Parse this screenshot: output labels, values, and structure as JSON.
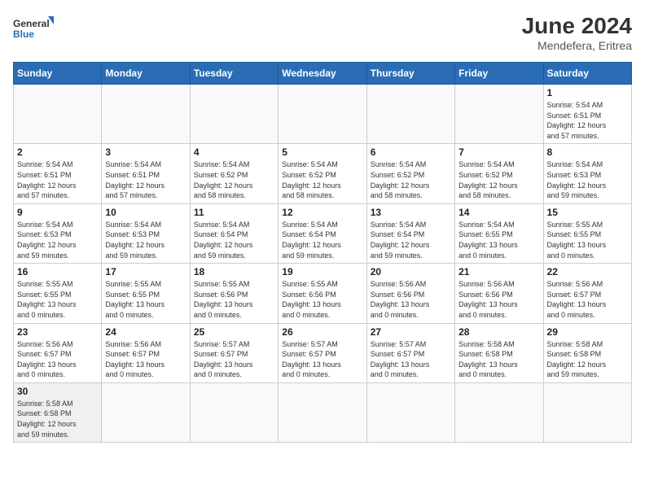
{
  "logo": {
    "general": "General",
    "blue": "Blue"
  },
  "header": {
    "month_year": "June 2024",
    "location": "Mendefera, Eritrea"
  },
  "weekdays": [
    "Sunday",
    "Monday",
    "Tuesday",
    "Wednesday",
    "Thursday",
    "Friday",
    "Saturday"
  ],
  "weeks": [
    [
      {
        "day": "",
        "info": ""
      },
      {
        "day": "",
        "info": ""
      },
      {
        "day": "",
        "info": ""
      },
      {
        "day": "",
        "info": ""
      },
      {
        "day": "",
        "info": ""
      },
      {
        "day": "",
        "info": ""
      },
      {
        "day": "1",
        "info": "Sunrise: 5:54 AM\nSunset: 6:51 PM\nDaylight: 12 hours\nand 57 minutes."
      }
    ],
    [
      {
        "day": "2",
        "info": "Sunrise: 5:54 AM\nSunset: 6:51 PM\nDaylight: 12 hours\nand 57 minutes."
      },
      {
        "day": "3",
        "info": "Sunrise: 5:54 AM\nSunset: 6:51 PM\nDaylight: 12 hours\nand 57 minutes."
      },
      {
        "day": "4",
        "info": "Sunrise: 5:54 AM\nSunset: 6:52 PM\nDaylight: 12 hours\nand 58 minutes."
      },
      {
        "day": "5",
        "info": "Sunrise: 5:54 AM\nSunset: 6:52 PM\nDaylight: 12 hours\nand 58 minutes."
      },
      {
        "day": "6",
        "info": "Sunrise: 5:54 AM\nSunset: 6:52 PM\nDaylight: 12 hours\nand 58 minutes."
      },
      {
        "day": "7",
        "info": "Sunrise: 5:54 AM\nSunset: 6:52 PM\nDaylight: 12 hours\nand 58 minutes."
      },
      {
        "day": "8",
        "info": "Sunrise: 5:54 AM\nSunset: 6:53 PM\nDaylight: 12 hours\nand 59 minutes."
      }
    ],
    [
      {
        "day": "9",
        "info": "Sunrise: 5:54 AM\nSunset: 6:53 PM\nDaylight: 12 hours\nand 59 minutes."
      },
      {
        "day": "10",
        "info": "Sunrise: 5:54 AM\nSunset: 6:53 PM\nDaylight: 12 hours\nand 59 minutes."
      },
      {
        "day": "11",
        "info": "Sunrise: 5:54 AM\nSunset: 6:54 PM\nDaylight: 12 hours\nand 59 minutes."
      },
      {
        "day": "12",
        "info": "Sunrise: 5:54 AM\nSunset: 6:54 PM\nDaylight: 12 hours\nand 59 minutes."
      },
      {
        "day": "13",
        "info": "Sunrise: 5:54 AM\nSunset: 6:54 PM\nDaylight: 12 hours\nand 59 minutes."
      },
      {
        "day": "14",
        "info": "Sunrise: 5:54 AM\nSunset: 6:55 PM\nDaylight: 13 hours\nand 0 minutes."
      },
      {
        "day": "15",
        "info": "Sunrise: 5:55 AM\nSunset: 6:55 PM\nDaylight: 13 hours\nand 0 minutes."
      }
    ],
    [
      {
        "day": "16",
        "info": "Sunrise: 5:55 AM\nSunset: 6:55 PM\nDaylight: 13 hours\nand 0 minutes."
      },
      {
        "day": "17",
        "info": "Sunrise: 5:55 AM\nSunset: 6:55 PM\nDaylight: 13 hours\nand 0 minutes."
      },
      {
        "day": "18",
        "info": "Sunrise: 5:55 AM\nSunset: 6:56 PM\nDaylight: 13 hours\nand 0 minutes."
      },
      {
        "day": "19",
        "info": "Sunrise: 5:55 AM\nSunset: 6:56 PM\nDaylight: 13 hours\nand 0 minutes."
      },
      {
        "day": "20",
        "info": "Sunrise: 5:56 AM\nSunset: 6:56 PM\nDaylight: 13 hours\nand 0 minutes."
      },
      {
        "day": "21",
        "info": "Sunrise: 5:56 AM\nSunset: 6:56 PM\nDaylight: 13 hours\nand 0 minutes."
      },
      {
        "day": "22",
        "info": "Sunrise: 5:56 AM\nSunset: 6:57 PM\nDaylight: 13 hours\nand 0 minutes."
      }
    ],
    [
      {
        "day": "23",
        "info": "Sunrise: 5:56 AM\nSunset: 6:57 PM\nDaylight: 13 hours\nand 0 minutes."
      },
      {
        "day": "24",
        "info": "Sunrise: 5:56 AM\nSunset: 6:57 PM\nDaylight: 13 hours\nand 0 minutes."
      },
      {
        "day": "25",
        "info": "Sunrise: 5:57 AM\nSunset: 6:57 PM\nDaylight: 13 hours\nand 0 minutes."
      },
      {
        "day": "26",
        "info": "Sunrise: 5:57 AM\nSunset: 6:57 PM\nDaylight: 13 hours\nand 0 minutes."
      },
      {
        "day": "27",
        "info": "Sunrise: 5:57 AM\nSunset: 6:57 PM\nDaylight: 13 hours\nand 0 minutes."
      },
      {
        "day": "28",
        "info": "Sunrise: 5:58 AM\nSunset: 6:58 PM\nDaylight: 13 hours\nand 0 minutes."
      },
      {
        "day": "29",
        "info": "Sunrise: 5:58 AM\nSunset: 6:58 PM\nDaylight: 12 hours\nand 59 minutes."
      }
    ],
    [
      {
        "day": "30",
        "info": "Sunrise: 5:58 AM\nSunset: 6:58 PM\nDaylight: 12 hours\nand 59 minutes."
      },
      {
        "day": "",
        "info": ""
      },
      {
        "day": "",
        "info": ""
      },
      {
        "day": "",
        "info": ""
      },
      {
        "day": "",
        "info": ""
      },
      {
        "day": "",
        "info": ""
      },
      {
        "day": "",
        "info": ""
      }
    ]
  ]
}
